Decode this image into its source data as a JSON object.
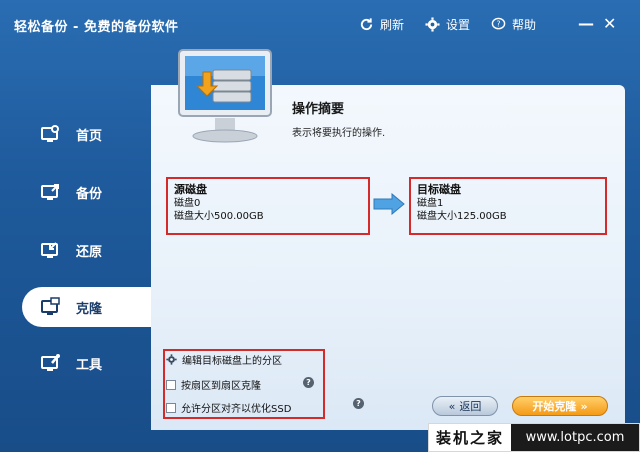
{
  "app": {
    "title": "轻松备份 - 免费的备份软件"
  },
  "toolbar": {
    "refresh_label": "刷新",
    "settings_label": "设置",
    "help_label": "帮助"
  },
  "window_controls": {
    "minimize": "—",
    "close": "✕"
  },
  "sidebar": {
    "items": [
      {
        "label": "首页",
        "icon": "home-icon"
      },
      {
        "label": "备份",
        "icon": "backup-icon"
      },
      {
        "label": "还原",
        "icon": "restore-icon"
      },
      {
        "label": "克隆",
        "icon": "clone-icon",
        "active": true
      },
      {
        "label": "工具",
        "icon": "tools-icon"
      }
    ]
  },
  "summary": {
    "title": "操作摘要",
    "subtitle": "表示将要执行的操作."
  },
  "source_disk": {
    "header": "源磁盘",
    "name": "磁盘0",
    "size": "磁盘大小500.00GB"
  },
  "target_disk": {
    "header": "目标磁盘",
    "name": "磁盘1",
    "size": "磁盘大小125.00GB"
  },
  "options": {
    "edit_partitions": "编辑目标磁盘上的分区",
    "sector_clone": "按扇区到扇区克隆",
    "align_ssd": "允许分区对齐以优化SSD"
  },
  "buttons": {
    "back": "返回",
    "start": "开始克隆",
    "back_icon": "«",
    "start_icon": "»"
  },
  "watermark": {
    "brand": "装机之家",
    "url": "www.lotpc.com"
  },
  "colors": {
    "accent_red": "#d42a2a",
    "sidebar_blue": "#1e5a9c",
    "start_orange": "#f59a16"
  }
}
